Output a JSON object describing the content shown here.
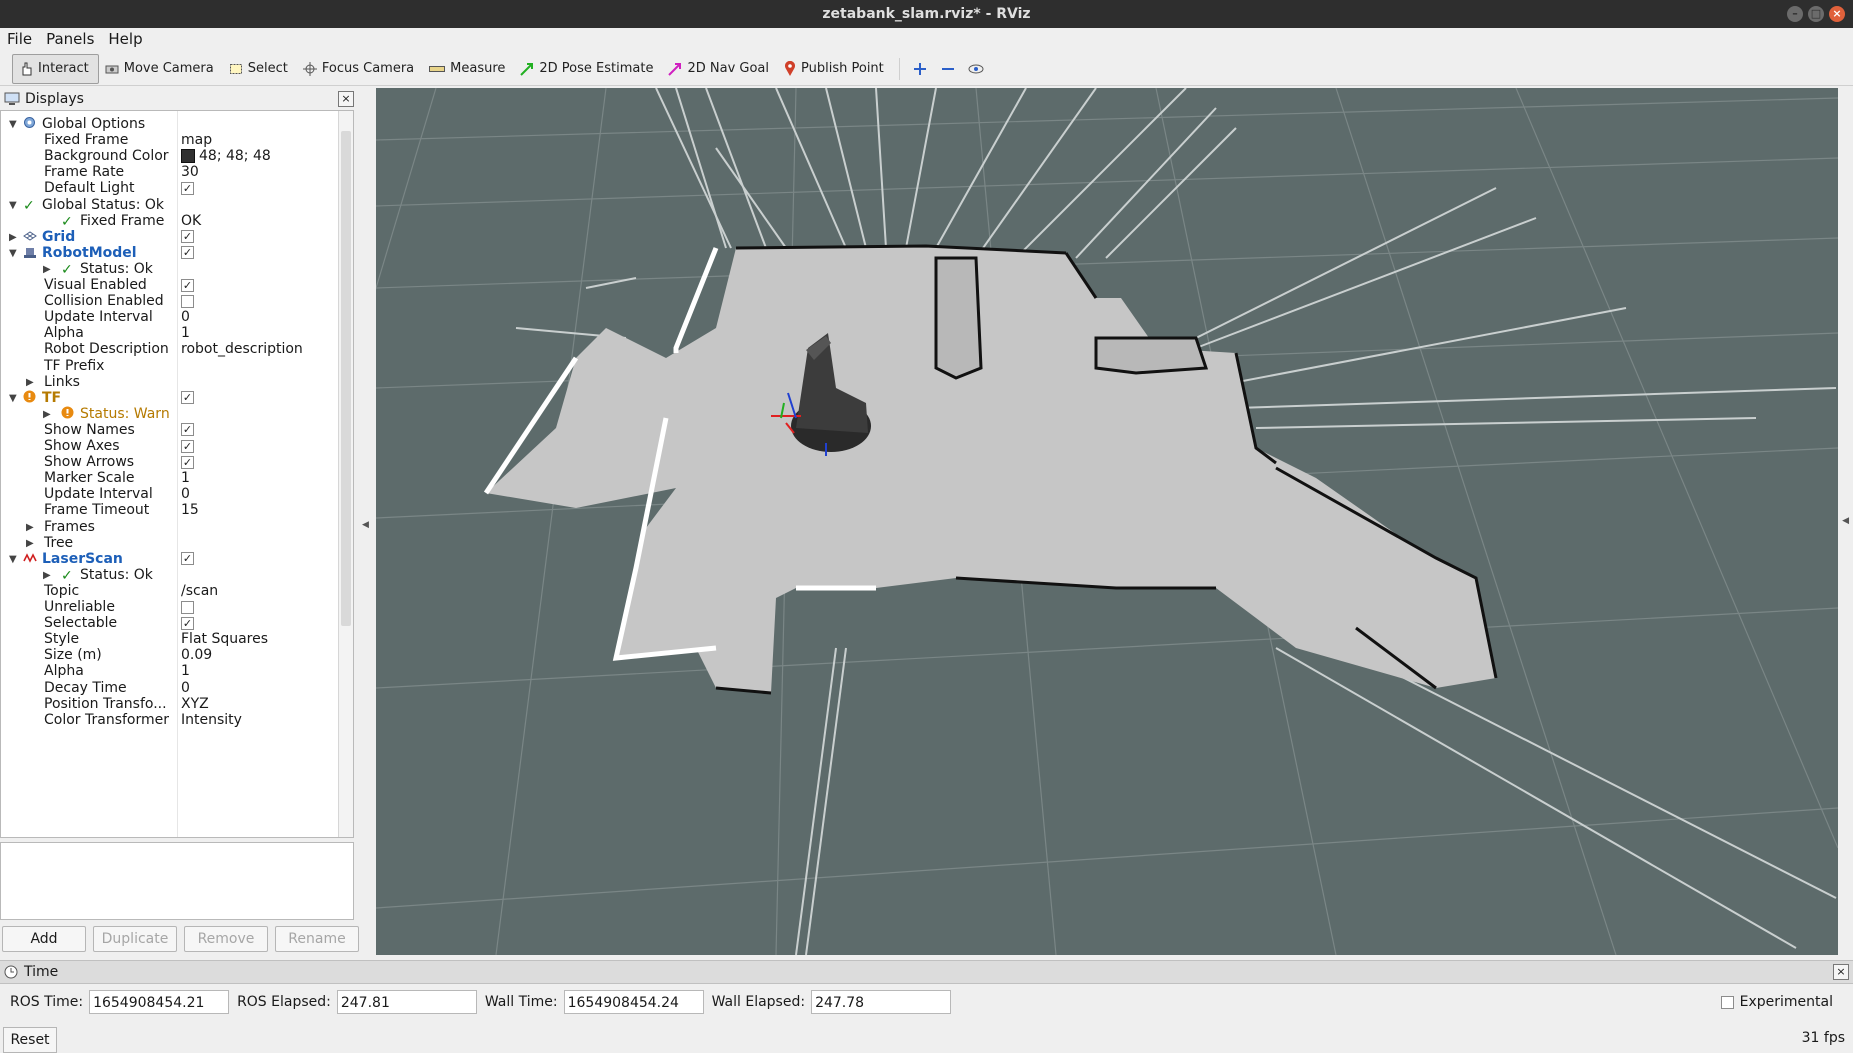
{
  "window": {
    "title": "zetabank_slam.rviz* - RViz"
  },
  "menu": [
    "File",
    "Panels",
    "Help"
  ],
  "toolbar": {
    "interact": "Interact",
    "move_camera": "Move Camera",
    "select": "Select",
    "focus_camera": "Focus Camera",
    "measure": "Measure",
    "pose_estimate": "2D Pose Estimate",
    "nav_goal": "2D Nav Goal",
    "publish_point": "Publish Point"
  },
  "displays": {
    "title": "Displays",
    "rows": [
      {
        "key": "Global Options",
        "value": "",
        "indent": 0,
        "arrow": "open",
        "icon": "gear-icon",
        "style": "",
        "check": ""
      },
      {
        "key": "Fixed Frame",
        "value": "map",
        "indent": 1,
        "arrow": "",
        "icon": "",
        "style": "",
        "check": ""
      },
      {
        "key": "Background Color",
        "value": "48; 48; 48",
        "indent": 1,
        "arrow": "",
        "icon": "",
        "style": "",
        "check": "",
        "swatch": "#303030"
      },
      {
        "key": "Frame Rate",
        "value": "30",
        "indent": 1,
        "arrow": "",
        "icon": "",
        "style": "",
        "check": ""
      },
      {
        "key": "Default Light",
        "value": "",
        "indent": 1,
        "arrow": "",
        "icon": "",
        "style": "",
        "check": "on"
      },
      {
        "key": "Global Status: Ok",
        "value": "",
        "indent": 0,
        "arrow": "open",
        "icon": "ok-icon",
        "style": "",
        "check": ""
      },
      {
        "key": "Fixed Frame",
        "value": "OK",
        "indent": 2,
        "arrow": "",
        "icon": "ok-icon",
        "style": "",
        "check": ""
      },
      {
        "key": "Grid",
        "value": "",
        "indent": 0,
        "arrow": "closed",
        "icon": "grid-icon",
        "style": "blue",
        "check": "on"
      },
      {
        "key": "RobotModel",
        "value": "",
        "indent": 0,
        "arrow": "open",
        "icon": "robot-icon",
        "style": "blue",
        "check": "on"
      },
      {
        "key": "Status: Ok",
        "value": "",
        "indent": 2,
        "arrow": "closed",
        "icon": "ok-icon",
        "style": "",
        "check": ""
      },
      {
        "key": "Visual Enabled",
        "value": "",
        "indent": 1,
        "arrow": "",
        "icon": "",
        "style": "",
        "check": "on"
      },
      {
        "key": "Collision Enabled",
        "value": "",
        "indent": 1,
        "arrow": "",
        "icon": "",
        "style": "",
        "check": "off"
      },
      {
        "key": "Update Interval",
        "value": "0",
        "indent": 1,
        "arrow": "",
        "icon": "",
        "style": "",
        "check": ""
      },
      {
        "key": "Alpha",
        "value": "1",
        "indent": 1,
        "arrow": "",
        "icon": "",
        "style": "",
        "check": ""
      },
      {
        "key": "Robot Description",
        "value": "robot_description",
        "indent": 1,
        "arrow": "",
        "icon": "",
        "style": "",
        "check": ""
      },
      {
        "key": "TF Prefix",
        "value": "",
        "indent": 1,
        "arrow": "",
        "icon": "",
        "style": "",
        "check": ""
      },
      {
        "key": "Links",
        "value": "",
        "indent": 1,
        "arrow": "closed",
        "icon": "",
        "style": "",
        "check": ""
      },
      {
        "key": "TF",
        "value": "",
        "indent": 0,
        "arrow": "open",
        "icon": "warn-icon",
        "style": "warnb",
        "check": "on"
      },
      {
        "key": "Status: Warn",
        "value": "",
        "indent": 2,
        "arrow": "closed",
        "icon": "warn-icon",
        "style": "warn",
        "check": ""
      },
      {
        "key": "Show Names",
        "value": "",
        "indent": 1,
        "arrow": "",
        "icon": "",
        "style": "",
        "check": "on"
      },
      {
        "key": "Show Axes",
        "value": "",
        "indent": 1,
        "arrow": "",
        "icon": "",
        "style": "",
        "check": "on"
      },
      {
        "key": "Show Arrows",
        "value": "",
        "indent": 1,
        "arrow": "",
        "icon": "",
        "style": "",
        "check": "on"
      },
      {
        "key": "Marker Scale",
        "value": "1",
        "indent": 1,
        "arrow": "",
        "icon": "",
        "style": "",
        "check": ""
      },
      {
        "key": "Update Interval",
        "value": "0",
        "indent": 1,
        "arrow": "",
        "icon": "",
        "style": "",
        "check": ""
      },
      {
        "key": "Frame Timeout",
        "value": "15",
        "indent": 1,
        "arrow": "",
        "icon": "",
        "style": "",
        "check": ""
      },
      {
        "key": "Frames",
        "value": "",
        "indent": 1,
        "arrow": "closed",
        "icon": "",
        "style": "",
        "check": ""
      },
      {
        "key": "Tree",
        "value": "",
        "indent": 1,
        "arrow": "closed",
        "icon": "",
        "style": "",
        "check": ""
      },
      {
        "key": "LaserScan",
        "value": "",
        "indent": 0,
        "arrow": "open",
        "icon": "laser-icon",
        "style": "blue",
        "check": "on"
      },
      {
        "key": "Status: Ok",
        "value": "",
        "indent": 2,
        "arrow": "closed",
        "icon": "ok-icon",
        "style": "",
        "check": ""
      },
      {
        "key": "Topic",
        "value": "/scan",
        "indent": 1,
        "arrow": "",
        "icon": "",
        "style": "",
        "check": ""
      },
      {
        "key": "Unreliable",
        "value": "",
        "indent": 1,
        "arrow": "",
        "icon": "",
        "style": "",
        "check": "off"
      },
      {
        "key": "Selectable",
        "value": "",
        "indent": 1,
        "arrow": "",
        "icon": "",
        "style": "",
        "check": "on"
      },
      {
        "key": "Style",
        "value": "Flat Squares",
        "indent": 1,
        "arrow": "",
        "icon": "",
        "style": "",
        "check": ""
      },
      {
        "key": "Size (m)",
        "value": "0.09",
        "indent": 1,
        "arrow": "",
        "icon": "",
        "style": "",
        "check": ""
      },
      {
        "key": "Alpha",
        "value": "1",
        "indent": 1,
        "arrow": "",
        "icon": "",
        "style": "",
        "check": ""
      },
      {
        "key": "Decay Time",
        "value": "0",
        "indent": 1,
        "arrow": "",
        "icon": "",
        "style": "",
        "check": ""
      },
      {
        "key": "Position Transfo...",
        "value": "XYZ",
        "indent": 1,
        "arrow": "",
        "icon": "",
        "style": "",
        "check": ""
      },
      {
        "key": "Color Transformer",
        "value": "Intensity",
        "indent": 1,
        "arrow": "",
        "icon": "",
        "style": "",
        "check": ""
      }
    ],
    "buttons": {
      "add": "Add",
      "duplicate": "Duplicate",
      "remove": "Remove",
      "rename": "Rename"
    }
  },
  "time_panel": {
    "title": "Time",
    "ros_time_label": "ROS Time:",
    "ros_time": "1654908454.21",
    "ros_elapsed_label": "ROS Elapsed:",
    "ros_elapsed": "247.81",
    "wall_time_label": "Wall Time:",
    "wall_time": "1654908454.24",
    "wall_elapsed_label": "Wall Elapsed:",
    "wall_elapsed": "247.78",
    "experimental": "Experimental",
    "reset": "Reset",
    "fps": "31 fps"
  },
  "colors": {
    "view_bg": "#5d6b6b",
    "map_free": "#c4c4c4",
    "accent_blue": "#1d5fb8",
    "warn": "#e28a00"
  }
}
